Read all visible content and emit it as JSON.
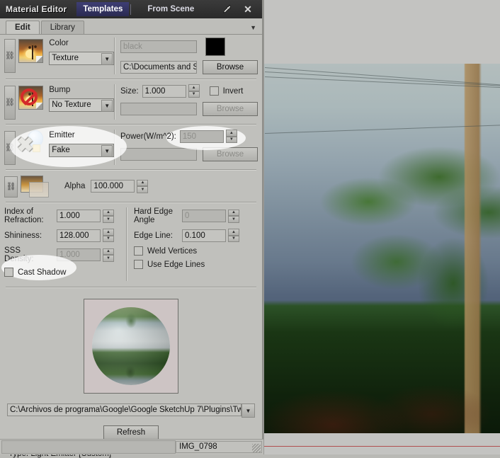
{
  "window": {
    "title": "Material Editor",
    "tabs": [
      {
        "label": "Templates",
        "active": true
      },
      {
        "label": "From Scene",
        "active": false
      }
    ],
    "pipette_icon": "eyedropper-icon",
    "close_icon": "close-icon"
  },
  "tabstrip": {
    "tabs": [
      {
        "label": "Edit",
        "selected": true
      },
      {
        "label": "Library",
        "selected": false
      }
    ],
    "menu_arrow": "▼"
  },
  "slots": {
    "color": {
      "label": "Color",
      "mode": "Texture",
      "value_placeholder": "black",
      "path": "C:\\Documents and S",
      "browse_label": "Browse",
      "swatch_color": "#000000"
    },
    "bump": {
      "label": "Bump",
      "mode": "No Texture",
      "size_label": "Size:",
      "size_value": "1.000",
      "invert_label": "Invert",
      "invert_checked": false,
      "path": "",
      "browse_label": "Browse"
    },
    "emitter": {
      "label": "Emitter",
      "mode": "Fake",
      "power_label": "Power(W/m^2):",
      "power_value": "150",
      "path": "",
      "browse_label": "Browse"
    },
    "alpha": {
      "label": "Alpha",
      "value": "100.000"
    }
  },
  "params": {
    "index_of_refraction_label": "Index of\nRefraction:",
    "index_of_refraction_value": "1.000",
    "shininess_label": "Shininess:",
    "shininess_value": "128.000",
    "sss_density_label": "SSS\nDensity:",
    "sss_density_value": "1.000",
    "cast_shadow_label": "Cast Shadow",
    "cast_shadow_checked": false,
    "hard_edge_angle_label": "Hard Edge\nAngle",
    "hard_edge_angle_value": "0",
    "edge_line_label": "Edge Line:",
    "edge_line_value": "0.100",
    "weld_vertices_label": "Weld Vertices",
    "weld_vertices_checked": false,
    "use_edge_lines_label": "Use Edge Lines",
    "use_edge_lines_checked": false
  },
  "footer": {
    "library_path": "C:\\Archivos de programa\\Google\\Google SketchUp 7\\Plugins\\Twilight\\l",
    "refresh_label": "Refresh",
    "type_text": "Type: Light Emitter [Custom]"
  },
  "statusbar": {
    "left_text": "",
    "right_text": "IMG_0798"
  },
  "spinner": {
    "up": "▲",
    "down": "▼"
  },
  "colors": {
    "panel_bg": "#c0c0bc",
    "titlebar_bg": "#2a2a2a",
    "tab_active_bg": "#3e3e74",
    "highlight_overlay": "#ffffff"
  }
}
